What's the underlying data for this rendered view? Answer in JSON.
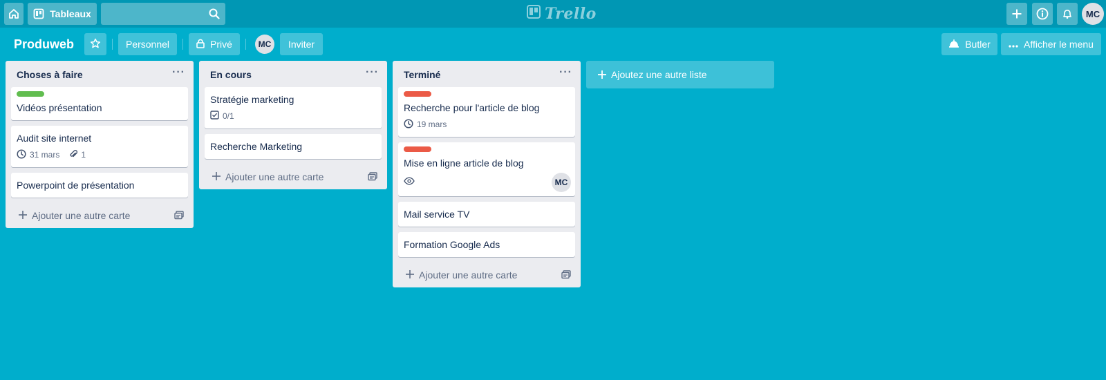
{
  "header": {
    "boards_label": "Tableaux",
    "search_value": "",
    "logo_text": "Trello",
    "user_initials": "MC",
    "icons": [
      "home-icon",
      "boards-icon",
      "search-icon",
      "plus-icon",
      "info-icon",
      "bell-icon"
    ]
  },
  "board": {
    "title": "Produweb",
    "team_label": "Personnel",
    "visibility_label": "Privé",
    "member_initials": "MC",
    "invite_label": "Inviter",
    "butler_label": "Butler",
    "menu_label": "Afficher le menu"
  },
  "lists": [
    {
      "title": "Choses à faire",
      "cards": [
        {
          "title": "Vidéos présentation",
          "label_color": "#61bd4f"
        },
        {
          "title": "Audit site internet",
          "due": "31 mars",
          "attachments": "1"
        },
        {
          "title": "Powerpoint de présentation"
        }
      ],
      "add_label": "Ajouter une autre carte"
    },
    {
      "title": "En cours",
      "cards": [
        {
          "title": "Stratégie marketing",
          "checklist": "0/1"
        },
        {
          "title": "Recherche Marketing"
        }
      ],
      "add_label": "Ajouter une autre carte"
    },
    {
      "title": "Terminé",
      "cards": [
        {
          "title": "Recherche pour l'article de blog",
          "label_color": "#eb5a46",
          "due": "19 mars"
        },
        {
          "title": "Mise en ligne article de blog",
          "label_color": "#eb5a46",
          "member": "MC"
        },
        {
          "title": "Mail service TV"
        },
        {
          "title": "Formation Google Ads"
        }
      ],
      "add_label": "Ajouter une autre carte"
    }
  ],
  "add_list_label": "Ajoutez une autre liste",
  "colors": {
    "background": "#00AECC",
    "header": "#0097B4",
    "label_green": "#61bd4f",
    "label_red": "#eb5a46"
  }
}
